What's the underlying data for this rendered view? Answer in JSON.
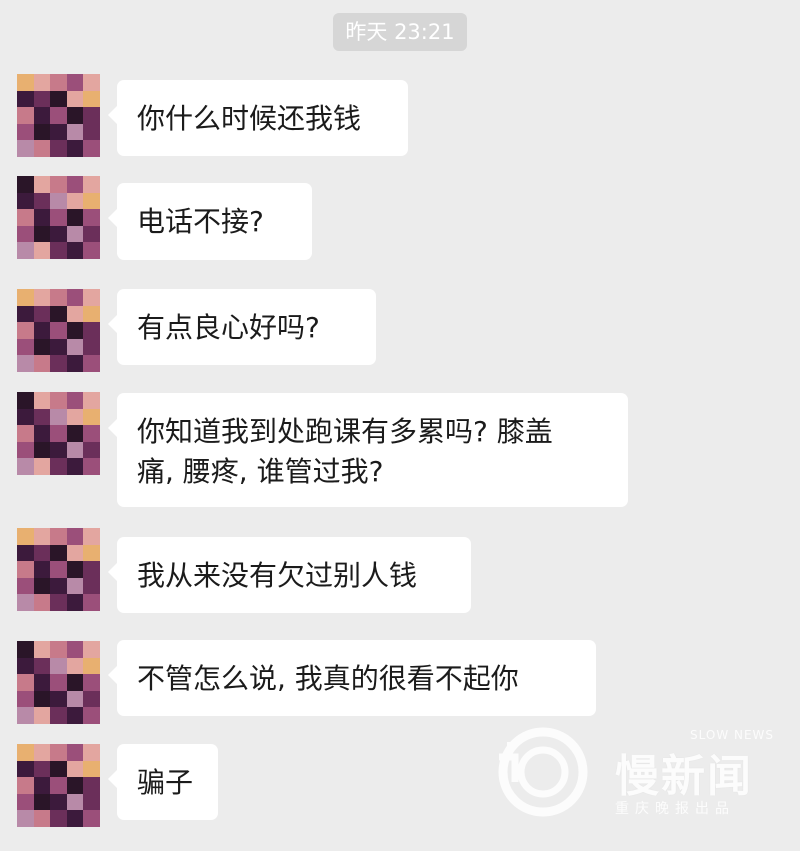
{
  "chat": {
    "timestamp": "昨天 23:21",
    "messages": [
      {
        "text": "你什么时候还我钱"
      },
      {
        "text": "电话不接?"
      },
      {
        "text": "有点良心好吗?"
      },
      {
        "text": "你知道我到处跑课有多累吗? 膝盖\n痛, 腰疼, 谁管过我?"
      },
      {
        "text": "我从来没有欠过别人钱"
      },
      {
        "text": "不管怎么说, 我真的很看不起你"
      },
      {
        "text": "骗子"
      }
    ]
  },
  "watermark": {
    "brand": "慢新闻",
    "english": "SLOW NEWS",
    "subtitle": "重庆晚报出品"
  },
  "colors": {
    "background": "#ececec",
    "bubble": "#ffffff",
    "timestamp_bg": "#d6d6d6",
    "avatar_palette": [
      "#3c1a3c",
      "#6b2f5a",
      "#9b4f7a",
      "#c77a8a",
      "#e3a6a0",
      "#e8b070",
      "#2a1528",
      "#b88aa8"
    ]
  }
}
